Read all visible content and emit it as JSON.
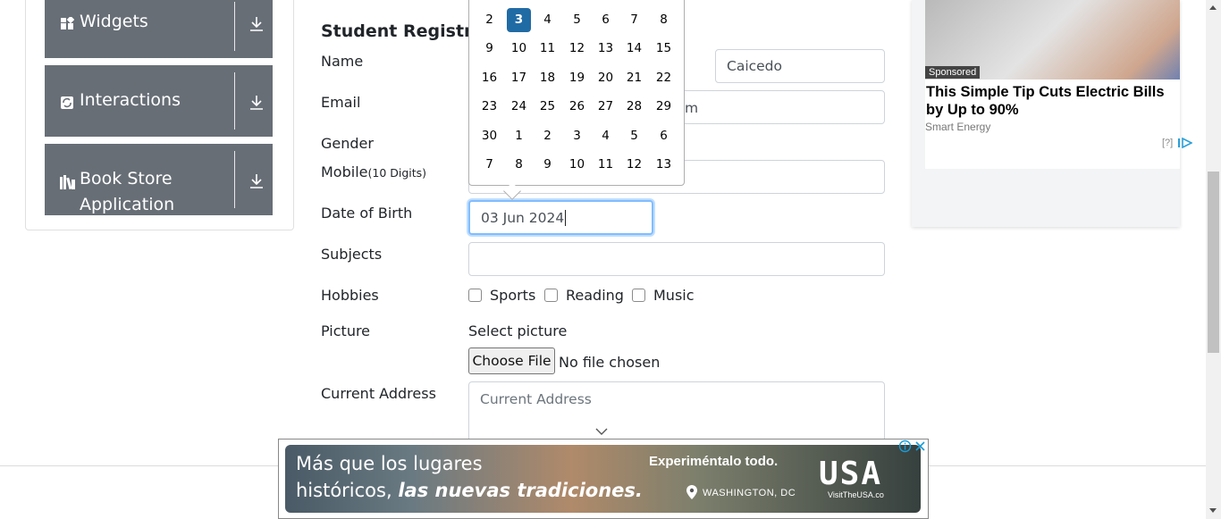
{
  "sidebar": {
    "groups": [
      {
        "label": "Widgets",
        "icon": "widgets-icon"
      },
      {
        "label": "Interactions",
        "icon": "interactions-icon"
      },
      {
        "label": "Book Store",
        "label2": "Application",
        "icon": "book-store-icon"
      }
    ]
  },
  "form": {
    "heading": "Student Registration Form",
    "name_label": "Name",
    "last_name_value": "Caicedo",
    "email_label": "Email",
    "email_value_tail": "m",
    "gender_label": "Gender",
    "mobile_label": "Mobile",
    "mobile_hint": "(10 Digits)",
    "dob_label": "Date of Birth",
    "dob_value": "03 Jun 2024",
    "subjects_label": "Subjects",
    "hobbies_label": "Hobbies",
    "hobbies": [
      "Sports",
      "Reading",
      "Music"
    ],
    "picture_label": "Picture",
    "select_picture": "Select picture",
    "choose_file": "Choose File",
    "no_file": "No file chosen",
    "address_label": "Current Address",
    "address_placeholder": "Current Address"
  },
  "calendar": {
    "selected": "3",
    "weeks": [
      [
        "2",
        "3",
        "4",
        "5",
        "6",
        "7",
        "8"
      ],
      [
        "9",
        "10",
        "11",
        "12",
        "13",
        "14",
        "15"
      ],
      [
        "16",
        "17",
        "18",
        "19",
        "20",
        "21",
        "22"
      ],
      [
        "23",
        "24",
        "25",
        "26",
        "27",
        "28",
        "29"
      ],
      [
        "30",
        "1",
        "2",
        "3",
        "4",
        "5",
        "6"
      ],
      [
        "7",
        "8",
        "9",
        "10",
        "11",
        "12",
        "13"
      ]
    ]
  },
  "ad": {
    "sponsored": "Sponsored",
    "title": "This Simple Tip Cuts Electric Bills by Up to 90%",
    "source": "Smart Energy",
    "info": "[?]"
  },
  "banner": {
    "line1": "Más que los lugares",
    "line2_plain": "históricos,",
    "line2_bold": "las nuevas tradiciones.",
    "tagline": "Experiméntalo todo.",
    "location": "WASHINGTON, DC",
    "brand": "USA",
    "site": "VisitTheUSA.co"
  }
}
